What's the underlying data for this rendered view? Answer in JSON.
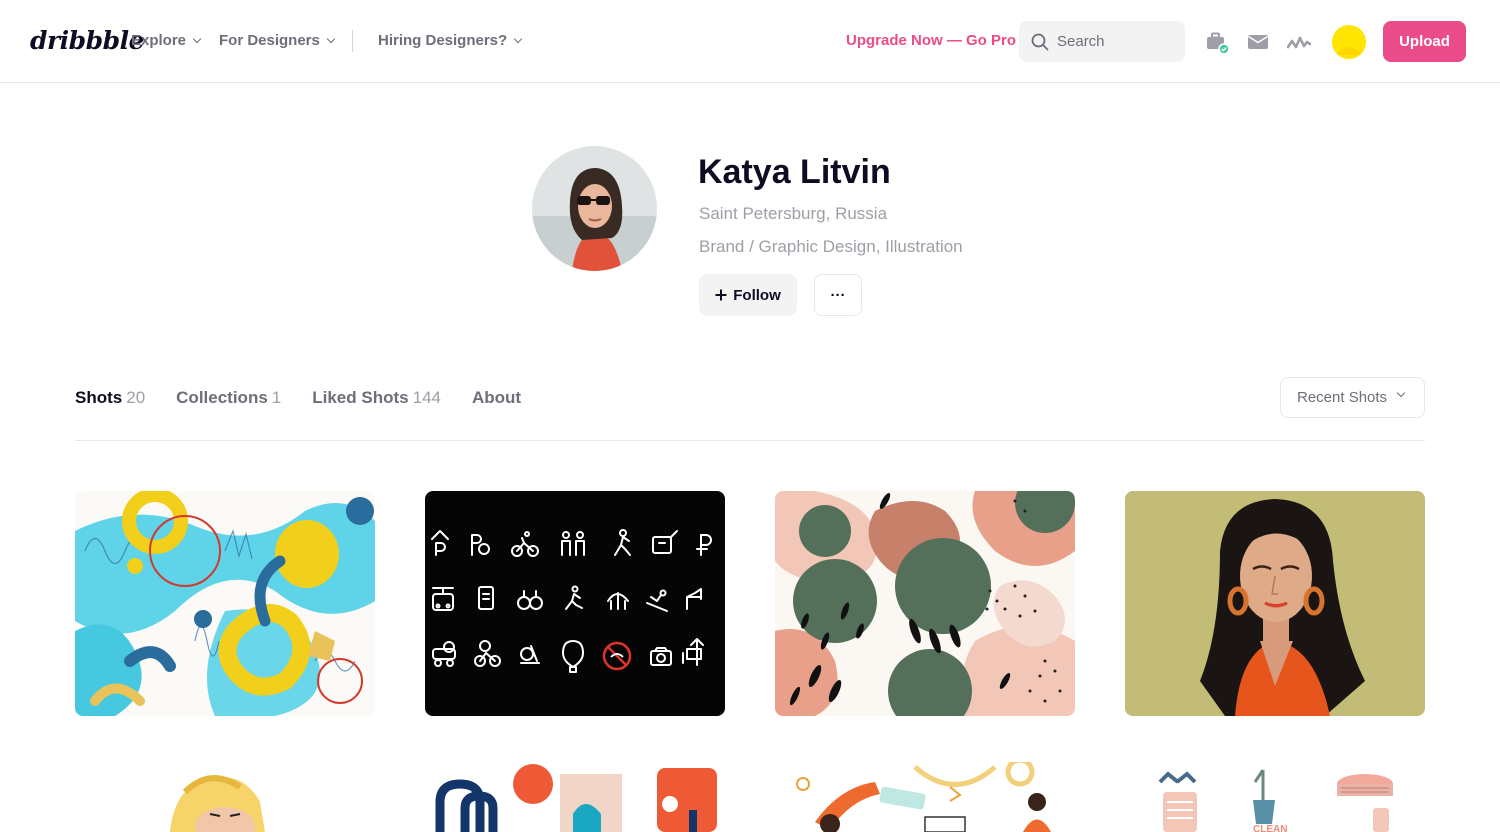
{
  "header": {
    "logo_text": "dribbble",
    "nav": [
      "Explore",
      "For Designers",
      "Hiring Designers?"
    ],
    "upgrade_text": "Upgrade Now — Go Pro",
    "search_placeholder": "Search",
    "icons": [
      "briefcase-icon",
      "mail-icon",
      "activity-icon",
      "user-avatar"
    ],
    "upload_label": "Upload",
    "accent_color": "#ea4c89"
  },
  "profile": {
    "name": "Katya Litvin",
    "location": "Saint Petersburg, Russia",
    "skills": "Brand / Graphic Design, Illustration",
    "follow_label": "Follow",
    "more_label": "···"
  },
  "tabs": [
    {
      "label": "Shots",
      "count": "20"
    },
    {
      "label": "Collections",
      "count": "1"
    },
    {
      "label": "Liked Shots",
      "count": "144"
    },
    {
      "label": "About",
      "count": ""
    }
  ],
  "sort": {
    "selected": "Recent Shots"
  },
  "shots": [
    {
      "theme": "abstract-yellow-blue"
    },
    {
      "theme": "icon-set-black"
    },
    {
      "theme": "pattern-green-pink"
    },
    {
      "theme": "portrait-woman-red"
    },
    {
      "theme": "illustration-blonde"
    },
    {
      "theme": "shapes-colorful"
    },
    {
      "theme": "illustration-people"
    },
    {
      "theme": "illustration-clean"
    }
  ]
}
